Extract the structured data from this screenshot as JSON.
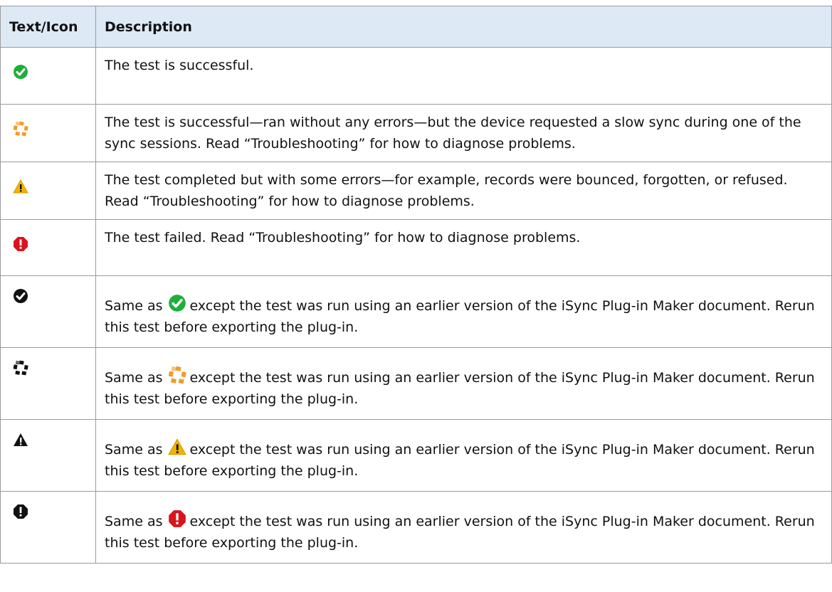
{
  "header": {
    "col_icon": "Text/Icon",
    "col_description": "Description"
  },
  "colors": {
    "header_bg": "#dde9f5",
    "success": "#1fae3a",
    "slow_sync": "#f29b28",
    "warning": "#f2b400",
    "failure": "#d9141c",
    "outdated": "#111111"
  },
  "rows": [
    {
      "icon": "green-check-icon",
      "text": "The test is successful."
    },
    {
      "icon": "orange-slow-sync-icon",
      "text": "The test is successful—ran without any errors—but the device requested a slow sync during one of the sync sessions. Read “Troubleshooting” for how to diagnose problems."
    },
    {
      "icon": "yellow-warning-icon",
      "text": "The test completed but with some errors—for example, records were bounced, forgotten, or refused. Read “Troubleshooting” for how to diagnose problems."
    },
    {
      "icon": "red-exclamation-icon",
      "text": "The test failed. Read “Troubleshooting” for how to diagnose problems."
    },
    {
      "icon": "black-check-icon",
      "prefix": "Same as",
      "inline_icon": "green-check-icon",
      "suffix": "except the test was run using an earlier version of the iSync Plug-in Maker document. Rerun this test before exporting the plug-in."
    },
    {
      "icon": "black-slow-sync-icon",
      "prefix": "Same as",
      "inline_icon": "orange-slow-sync-icon",
      "suffix": "except the test was run using an earlier version of the iSync Plug-in Maker document. Rerun this test before exporting the plug-in."
    },
    {
      "icon": "black-warning-icon",
      "prefix": "Same as",
      "inline_icon": "yellow-warning-icon",
      "suffix": "except the test was run using an earlier version of the iSync Plug-in Maker document. Rerun this test before exporting the plug-in."
    },
    {
      "icon": "black-exclamation-icon",
      "prefix": "Same as",
      "inline_icon": "red-exclamation-icon",
      "suffix": "except the test was run using an earlier version of the iSync Plug-in Maker document. Rerun this test before exporting the plug-in."
    }
  ]
}
